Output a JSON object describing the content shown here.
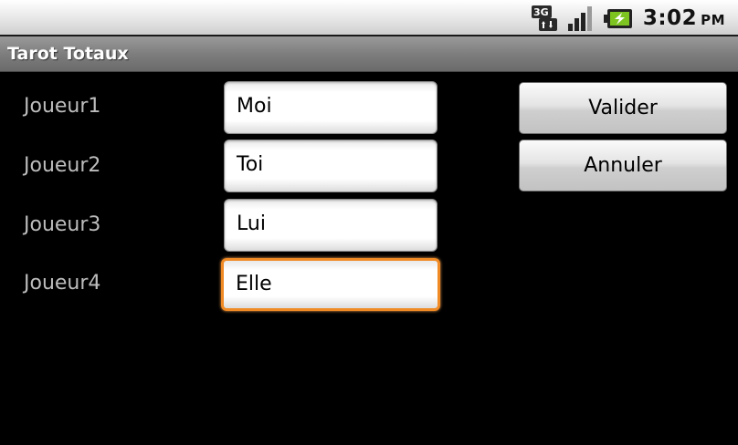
{
  "status_bar": {
    "network_icon": "3g-data-icon",
    "signal_icon": "signal-strength-icon",
    "battery_icon": "battery-charging-icon",
    "time": "3:02",
    "ampm": "PM"
  },
  "app": {
    "title": "Tarot Totaux"
  },
  "players": [
    {
      "label": "Joueur1",
      "value": "Moi"
    },
    {
      "label": "Joueur2",
      "value": "Toi"
    },
    {
      "label": "Joueur3",
      "value": "Lui"
    },
    {
      "label": "Joueur4",
      "value": "Elle"
    }
  ],
  "buttons": {
    "validate_label": "Valider",
    "cancel_label": "Annuler"
  },
  "colors": {
    "focus_accent": "#f08a24",
    "battery_green": "#7ec421"
  }
}
